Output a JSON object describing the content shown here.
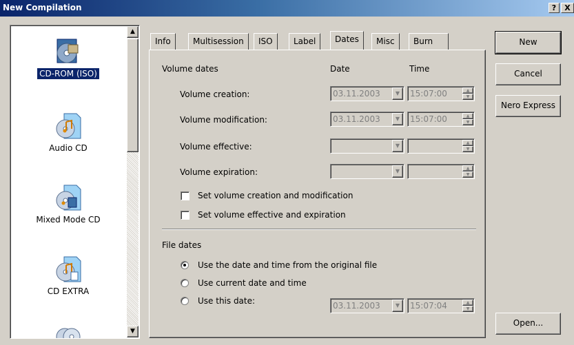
{
  "window": {
    "title": "New Compilation",
    "help_btn": "?",
    "close_btn": "X"
  },
  "compilation_types": [
    {
      "label": "CD-ROM (ISO)",
      "icon": "cd-rom-iso-icon",
      "selected": true
    },
    {
      "label": "Audio CD",
      "icon": "audio-cd-icon",
      "selected": false
    },
    {
      "label": "Mixed Mode CD",
      "icon": "mixed-mode-cd-icon",
      "selected": false
    },
    {
      "label": "CD EXTRA",
      "icon": "cd-extra-icon",
      "selected": false
    }
  ],
  "tabs": [
    "Info",
    "Multisession",
    "ISO",
    "Label",
    "Dates",
    "Misc",
    "Burn"
  ],
  "active_tab": "Dates",
  "volume_dates": {
    "heading": "Volume dates",
    "col_date": "Date",
    "col_time": "Time",
    "rows": [
      {
        "label": "Volume creation:",
        "date": "03.11.2003",
        "time": "15:07:00"
      },
      {
        "label": "Volume modification:",
        "date": "03.11.2003",
        "time": "15:07:00"
      },
      {
        "label": "Volume effective:",
        "date": "",
        "time": ""
      },
      {
        "label": "Volume expiration:",
        "date": "",
        "time": ""
      }
    ],
    "checkboxes": [
      {
        "label": "Set volume creation and modification",
        "checked": false
      },
      {
        "label": "Set volume effective and expiration",
        "checked": false
      }
    ]
  },
  "file_dates": {
    "heading": "File dates",
    "options": [
      {
        "label": "Use the date and time from the original file",
        "selected": true
      },
      {
        "label": "Use current date and time",
        "selected": false
      },
      {
        "label": "Use this date:",
        "selected": false
      }
    ],
    "this_date": "03.11.2003",
    "this_time": "15:07:04"
  },
  "buttons": {
    "new": "New",
    "cancel": "Cancel",
    "nero_express": "Nero Express",
    "open": "Open..."
  },
  "colors": {
    "selection": "#0a246a",
    "face": "#d4d0c8",
    "title_start": "#0a246a",
    "title_end": "#a6caf0"
  }
}
